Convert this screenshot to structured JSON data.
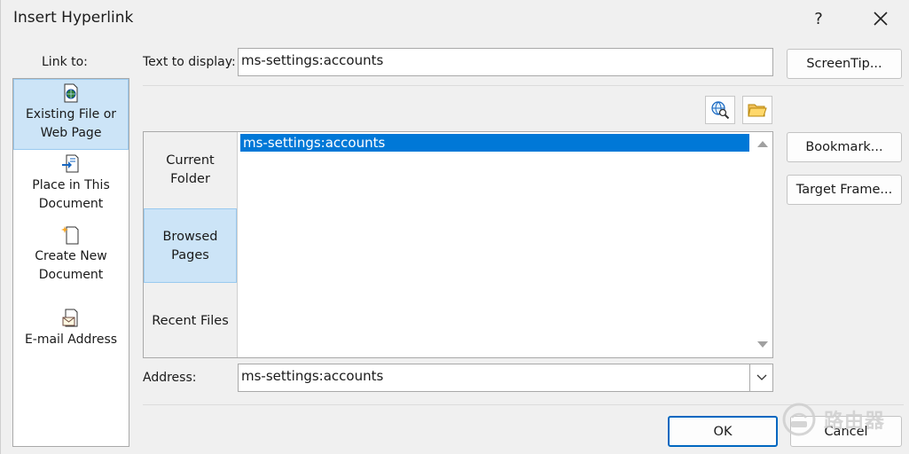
{
  "window": {
    "title": "Insert Hyperlink",
    "help_label": "?",
    "close_label": "✕"
  },
  "link_to": {
    "label": "Link to:",
    "items": [
      {
        "line1": "Existing File or",
        "line2": "Web Page",
        "icon": "existing-file-icon",
        "selected": true
      },
      {
        "line1": "Place in This",
        "line2": "Document",
        "icon": "place-in-document-icon",
        "selected": false
      },
      {
        "line1": "Create New",
        "line2": "Document",
        "icon": "create-new-document-icon",
        "selected": false
      },
      {
        "line1": "E-mail Address",
        "line2": "",
        "icon": "email-address-icon",
        "selected": false
      }
    ]
  },
  "text_to_display": {
    "label": "Text to display:",
    "value": "ms-settings:accounts"
  },
  "buttons": {
    "screentip": "ScreenTip...",
    "bookmark": "Bookmark...",
    "target_frame": "Target Frame...",
    "ok": "OK",
    "cancel": "Cancel"
  },
  "tools": {
    "browse_web": "browse-web-icon",
    "browse_file": "browse-file-folder-icon"
  },
  "look_in": {
    "tabs": [
      {
        "line1": "Current",
        "line2": "Folder",
        "selected": false
      },
      {
        "line1": "Browsed",
        "line2": "Pages",
        "selected": true
      },
      {
        "line1": "Recent Files",
        "line2": "",
        "selected": false
      }
    ],
    "files": [
      "ms-settings:accounts"
    ]
  },
  "address": {
    "label": "Address:",
    "value": "ms-settings:accounts"
  },
  "watermark": {
    "text": "路由器"
  },
  "colors": {
    "selection": "#0078d7",
    "nav_selected": "#cce4f7",
    "primary_border": "#0067c0"
  }
}
